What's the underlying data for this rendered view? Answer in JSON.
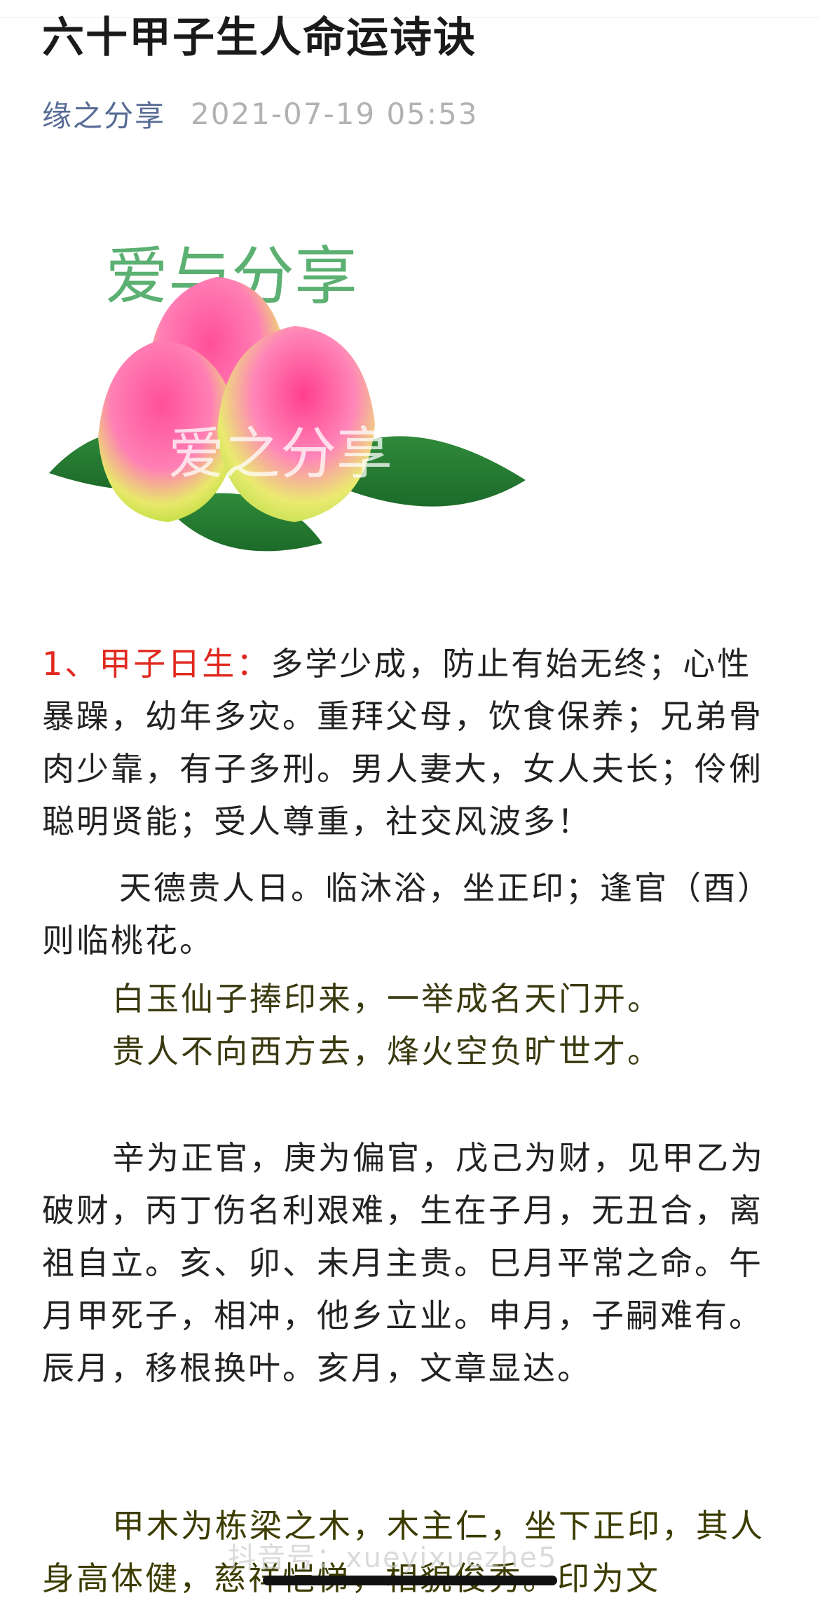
{
  "article": {
    "title": "六十甲子生人命运诗诀",
    "author": "缘之分享",
    "date": "2021-07-19 05:53"
  },
  "image": {
    "text_top": "爱与分享",
    "text_center": "爱之分享",
    "text_corner": "爱之分享"
  },
  "content": {
    "p1_label": "1、甲子日生：",
    "p1_text": "多学少成，防止有始无终；心性暴躁，幼年多灾。重拜父母，饮食保养；兄弟骨肉少靠，有子多刑。男人妻大，女人夫长；伶俐聪明贤能；受人尊重，社交风波多！",
    "p2_text": "天德贵人日。临沐浴，坐正印；逢官（酉）则临桃花。",
    "verse1": "白玉仙子捧印来，一举成名天门开。",
    "verse2": "贵人不向西方去，烽火空负旷世才。",
    "p3_text": "辛为正官，庚为偏官，戊己为财，见甲乙为破财，丙丁伤名利艰难，生在子月，无丑合，离祖自立。亥、卯、未月主贵。巳月平常之命。午月甲死子，相冲，他乡立业。申月，子嗣难有。辰月，移根换叶。亥月，文章显达。",
    "p4_text": "甲木为栋梁之木，木主仁，坐下正印，其人身高体健，慈祥恺悌，相貌俊秀。印为文"
  },
  "overlay": {
    "watermark": "抖音号：xueyixuezhe5"
  }
}
